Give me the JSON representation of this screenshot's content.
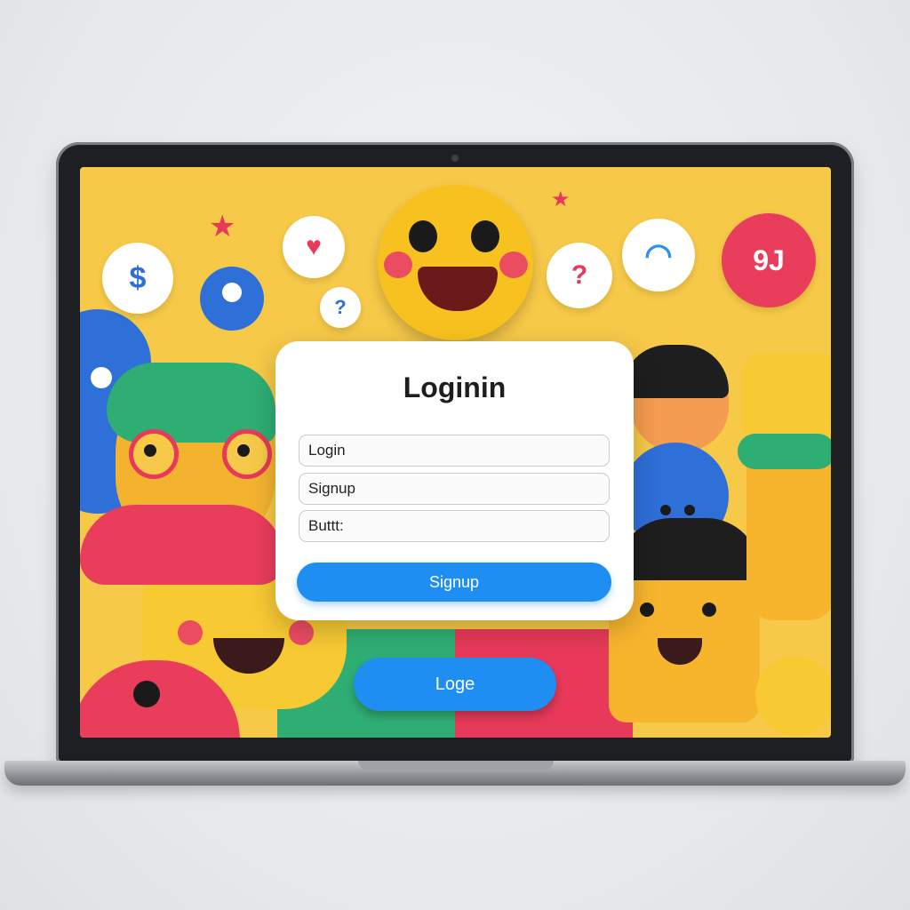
{
  "card": {
    "title": "Loginin",
    "fields": [
      {
        "value": "Login"
      },
      {
        "value": "Signup"
      },
      {
        "value": "Buttt:"
      }
    ],
    "signup_label": "Signup"
  },
  "screen": {
    "loge_label": "Loge"
  },
  "bubbles": {
    "dollar": "$",
    "question": "?",
    "question_small": "?",
    "speech_red": "9J"
  },
  "colors": {
    "background_yellow": "#f7c948",
    "primary_blue": "#1e8ef3",
    "accent_red": "#e8395a",
    "accent_green": "#2fae74"
  }
}
